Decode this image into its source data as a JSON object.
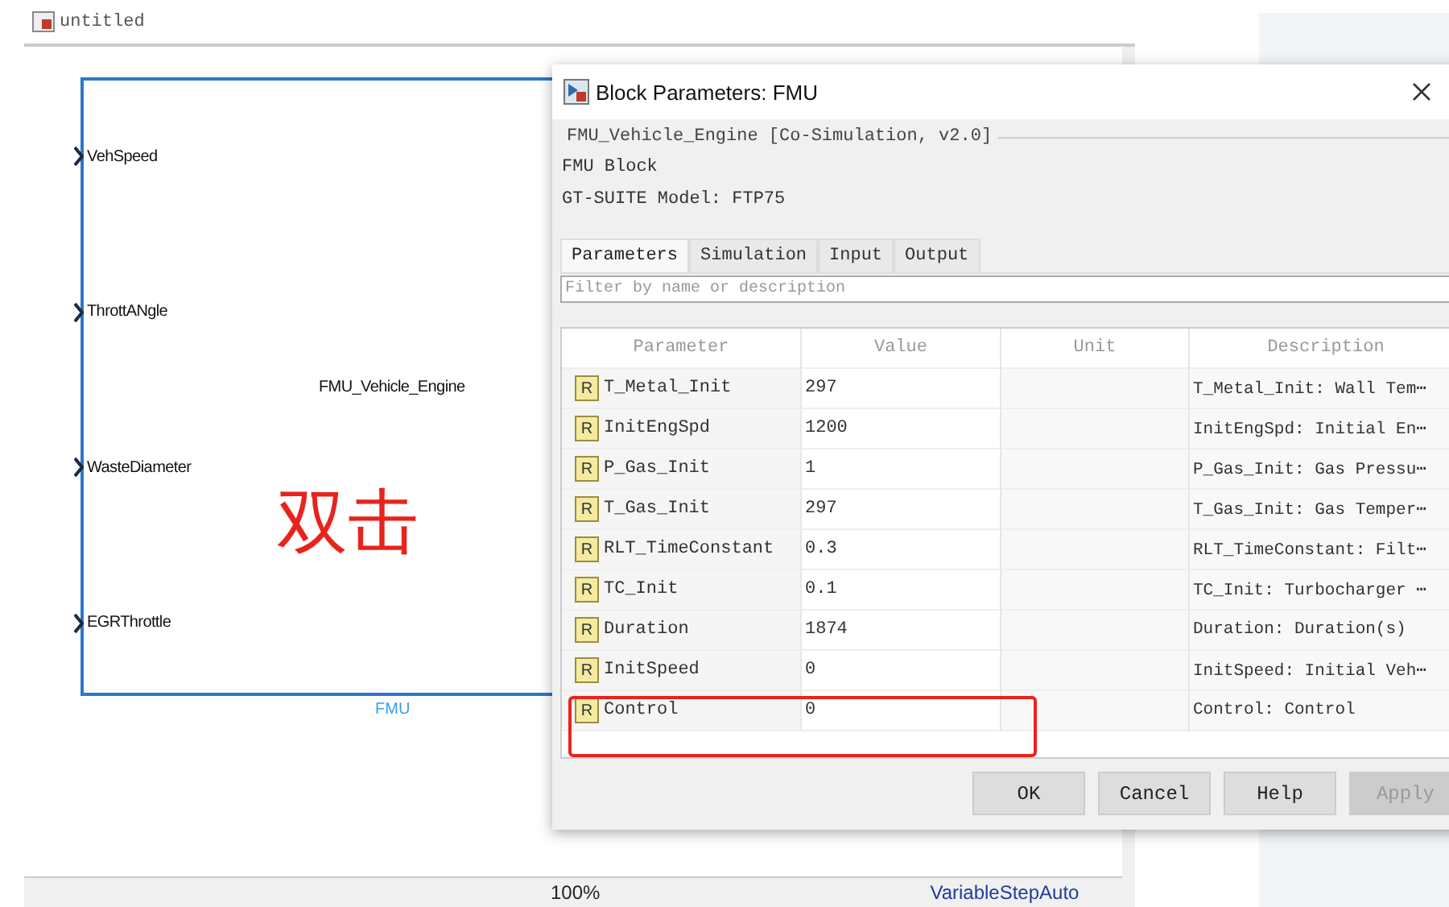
{
  "model_tab": {
    "title": "untitled"
  },
  "block": {
    "name": "FMU_Vehicle_Engine",
    "label": "FMU",
    "ports": [
      "VehSpeed",
      "ThrottANgle",
      "WasteDiameter",
      "EGRThrottle"
    ]
  },
  "annotation": {
    "text": "双击"
  },
  "status_bar": {
    "zoom": "100%",
    "solver": "VariableStepAuto"
  },
  "dialog": {
    "title": "Block Parameters: FMU",
    "group_title": "FMU_Vehicle_Engine [Co-Simulation, v2.0]",
    "lines": [
      "FMU Block",
      "GT-SUITE Model: FTP75"
    ],
    "tabs": [
      {
        "label": "Parameters",
        "selected": true
      },
      {
        "label": "Simulation",
        "selected": false
      },
      {
        "label": "Input",
        "selected": false
      },
      {
        "label": "Output",
        "selected": false
      }
    ],
    "filter": {
      "placeholder": "Filter by name or description"
    },
    "table": {
      "columns": [
        "Parameter",
        "Value",
        "Unit",
        "Description"
      ],
      "rows": [
        {
          "icon": "R",
          "parameter": "T_Metal_Init",
          "value": "297",
          "description": "T_Metal_Init: Wall Tem⋯"
        },
        {
          "icon": "R",
          "parameter": "InitEngSpd",
          "value": "1200",
          "description": "InitEngSpd: Initial En⋯"
        },
        {
          "icon": "R",
          "parameter": "P_Gas_Init",
          "value": "1",
          "description": "P_Gas_Init: Gas Pressu⋯"
        },
        {
          "icon": "R",
          "parameter": "T_Gas_Init",
          "value": "297",
          "description": "T_Gas_Init: Gas Temper⋯"
        },
        {
          "icon": "R",
          "parameter": "RLT_TimeConstant",
          "value": "0.3",
          "description": "RLT_TimeConstant: Filt⋯"
        },
        {
          "icon": "R",
          "parameter": "TC_Init",
          "value": "0.1",
          "description": "TC_Init: Turbocharger ⋯"
        },
        {
          "icon": "R",
          "parameter": "Duration",
          "value": "1874",
          "description": "Duration: Duration(s)"
        },
        {
          "icon": "R",
          "parameter": "InitSpeed",
          "value": "0",
          "description": "InitSpeed: Initial Veh⋯"
        },
        {
          "icon": "R",
          "parameter": "Control",
          "value": "0",
          "description": "Control: Control"
        }
      ]
    },
    "buttons": [
      {
        "label": "OK",
        "disabled": false
      },
      {
        "label": "Cancel",
        "disabled": false
      },
      {
        "label": "Help",
        "disabled": false
      },
      {
        "label": "Apply",
        "disabled": true
      }
    ]
  }
}
